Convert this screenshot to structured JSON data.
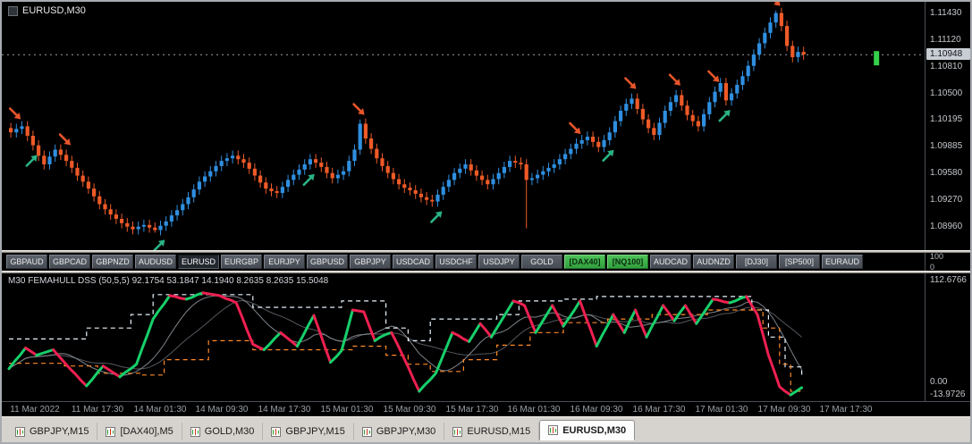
{
  "chart": {
    "symbol_label": "EURUSD,M30",
    "price_axis": {
      "labels": [
        "1.11430",
        "1.11120",
        "1.10810",
        "1.10500",
        "1.10195",
        "1.09885",
        "1.09580",
        "1.09270",
        "1.08960"
      ],
      "current": "1.10948"
    },
    "candles": {
      "closes": [
        1.1005,
        1.1009,
        1.1012,
        1.1001,
        1.099,
        1.0978,
        1.0968,
        1.0977,
        1.0985,
        1.0979,
        1.0972,
        1.0964,
        1.0955,
        1.0948,
        1.094,
        1.0931,
        1.0922,
        1.0916,
        1.091,
        1.0905,
        1.09,
        1.0896,
        1.0893,
        1.0896,
        1.0898,
        1.0895,
        1.0892,
        1.0897,
        1.0902,
        1.0909,
        1.0915,
        1.0922,
        1.093,
        1.0939,
        1.0948,
        1.0954,
        1.096,
        1.0966,
        1.0972,
        1.0975,
        1.0978,
        1.0974,
        1.097,
        1.0963,
        1.0955,
        1.0947,
        1.094,
        1.0937,
        1.0935,
        1.0942,
        1.095,
        1.0956,
        1.0962,
        1.0968,
        1.0974,
        1.097,
        1.0965,
        1.0958,
        1.0952,
        1.0956,
        1.096,
        1.0972,
        1.0985,
        1.1015,
        1.0998,
        1.0986,
        1.0975,
        1.0966,
        1.0958,
        1.0951,
        1.0945,
        1.0941,
        1.0938,
        1.0934,
        1.093,
        1.0927,
        1.0925,
        1.0933,
        1.0942,
        1.095,
        1.0958,
        1.0963,
        1.0968,
        1.0961,
        1.0955,
        1.095,
        1.0945,
        1.0951,
        1.0958,
        1.0965,
        1.0972,
        1.097,
        1.0968,
        1.095,
        1.0952,
        1.0956,
        1.096,
        1.0964,
        1.0968,
        1.0974,
        1.098,
        1.0986,
        1.0992,
        1.0996,
        1.1,
        1.0994,
        1.0988,
        1.0996,
        1.1005,
        1.1018,
        1.103,
        1.1038,
        1.1044,
        1.1032,
        1.102,
        1.101,
        1.1002,
        1.1016,
        1.103,
        1.104,
        1.1048,
        1.1036,
        1.1025,
        1.1018,
        1.1012,
        1.1026,
        1.104,
        1.1052,
        1.1062,
        1.1042,
        1.105,
        1.106,
        1.107,
        1.1082,
        1.1095,
        1.1108,
        1.112,
        1.1132,
        1.1143,
        1.1128,
        1.1105,
        1.1092,
        1.1098,
        1.1095
      ],
      "high_overrides": {
        "63": 1.102,
        "138": 1.1146
      },
      "low_overrides": {
        "26": 1.0889,
        "93": 1.0894
      }
    },
    "arrows": [
      {
        "i": 1,
        "dir": "down"
      },
      {
        "i": 4,
        "dir": "up"
      },
      {
        "i": 10,
        "dir": "down"
      },
      {
        "i": 27,
        "dir": "up"
      },
      {
        "i": 54,
        "dir": "up"
      },
      {
        "i": 63,
        "dir": "down"
      },
      {
        "i": 77,
        "dir": "up"
      },
      {
        "i": 102,
        "dir": "down"
      },
      {
        "i": 108,
        "dir": "up"
      },
      {
        "i": 112,
        "dir": "down"
      },
      {
        "i": 120,
        "dir": "down"
      },
      {
        "i": 127,
        "dir": "down"
      },
      {
        "i": 129,
        "dir": "up"
      },
      {
        "i": 138,
        "dir": "down"
      }
    ],
    "marker": {
      "i": 156,
      "color": "#35d04a"
    }
  },
  "ticker": {
    "axis_labels": [
      "100",
      "0"
    ],
    "buttons": [
      {
        "label": "GBPAUD",
        "variant": "default"
      },
      {
        "label": "GBPCAD",
        "variant": "default"
      },
      {
        "label": "GBPNZD",
        "variant": "default"
      },
      {
        "label": "AUDUSD",
        "variant": "default"
      },
      {
        "label": "EURUSD",
        "variant": "active"
      },
      {
        "label": "EURGBP",
        "variant": "default"
      },
      {
        "label": "EURJPY",
        "variant": "default"
      },
      {
        "label": "GBPUSD",
        "variant": "default"
      },
      {
        "label": "GBPJPY",
        "variant": "default"
      },
      {
        "label": "USDCAD",
        "variant": "default"
      },
      {
        "label": "USDCHF",
        "variant": "default"
      },
      {
        "label": "USDJPY",
        "variant": "default"
      },
      {
        "label": "GOLD",
        "variant": "default"
      },
      {
        "label": "[DAX40]",
        "variant": "green"
      },
      {
        "label": "[NQ100]",
        "variant": "green"
      },
      {
        "label": "AUDCAD",
        "variant": "default"
      },
      {
        "label": "AUDNZD",
        "variant": "default"
      },
      {
        "label": "[DJ30]",
        "variant": "default"
      },
      {
        "label": "[SP500]",
        "variant": "default"
      },
      {
        "label": "EURAUD",
        "variant": "default"
      }
    ]
  },
  "indicator": {
    "label": "M30 FEMAHULL DSS (50,5,5) 92.1754 53.1847 14.1940 8.2635 8.2635 15.5048",
    "axis_labels": [
      "112.6766",
      "0.00",
      "-13.9726"
    ],
    "hull": [
      15,
      23,
      30,
      38,
      34,
      30,
      32,
      34,
      36,
      29,
      22,
      15,
      9,
      2,
      -4,
      3,
      11,
      18,
      14,
      10,
      6,
      11,
      15,
      20,
      37,
      53,
      70,
      79,
      87,
      96,
      95,
      93,
      92,
      94,
      97,
      99,
      98,
      97,
      96,
      93,
      91,
      88,
      73,
      57,
      42,
      39,
      36,
      42,
      49,
      55,
      50,
      45,
      40,
      51,
      63,
      74,
      57,
      39,
      22,
      28,
      35,
      57,
      80,
      79,
      78,
      62,
      46,
      50,
      53,
      55,
      43,
      30,
      17,
      3,
      -10,
      -3,
      3,
      10,
      25,
      40,
      55,
      52,
      48,
      45,
      55,
      65,
      58,
      50,
      60,
      70,
      80,
      90,
      88,
      85,
      70,
      55,
      65,
      75,
      85,
      74,
      62,
      71,
      80,
      90,
      73,
      57,
      40,
      52,
      63,
      75,
      65,
      55,
      68,
      80,
      65,
      50,
      62,
      73,
      85,
      77,
      68,
      77,
      85,
      75,
      65,
      74,
      83,
      92,
      91,
      89,
      88,
      90,
      93,
      95,
      85,
      75,
      53,
      30,
      13,
      -5,
      -10,
      -14,
      -10,
      -6
    ],
    "upper_dashed": [
      {
        "i": 0,
        "v": 48
      },
      {
        "i": 8,
        "v": 48
      },
      {
        "i": 14,
        "v": 60
      },
      {
        "i": 22,
        "v": 75
      },
      {
        "i": 26,
        "v": 97
      },
      {
        "i": 40,
        "v": 97
      },
      {
        "i": 44,
        "v": 83
      },
      {
        "i": 56,
        "v": 83
      },
      {
        "i": 60,
        "v": 90
      },
      {
        "i": 66,
        "v": 90
      },
      {
        "i": 68,
        "v": 60
      },
      {
        "i": 72,
        "v": 46
      },
      {
        "i": 76,
        "v": 70
      },
      {
        "i": 88,
        "v": 75
      },
      {
        "i": 92,
        "v": 90
      },
      {
        "i": 100,
        "v": 92
      },
      {
        "i": 106,
        "v": 95
      },
      {
        "i": 132,
        "v": 95
      },
      {
        "i": 134,
        "v": 80
      },
      {
        "i": 137,
        "v": 50
      },
      {
        "i": 140,
        "v": 17
      },
      {
        "i": 143,
        "v": 8
      }
    ],
    "lower_dashed": [
      {
        "i": 0,
        "v": 21
      },
      {
        "i": 10,
        "v": 18
      },
      {
        "i": 16,
        "v": 10
      },
      {
        "i": 24,
        "v": 8
      },
      {
        "i": 28,
        "v": 25
      },
      {
        "i": 36,
        "v": 46
      },
      {
        "i": 44,
        "v": 36
      },
      {
        "i": 58,
        "v": 36
      },
      {
        "i": 62,
        "v": 40
      },
      {
        "i": 68,
        "v": 30
      },
      {
        "i": 72,
        "v": 20
      },
      {
        "i": 76,
        "v": 12
      },
      {
        "i": 82,
        "v": 25
      },
      {
        "i": 88,
        "v": 41
      },
      {
        "i": 94,
        "v": 55
      },
      {
        "i": 100,
        "v": 66
      },
      {
        "i": 108,
        "v": 70
      },
      {
        "i": 116,
        "v": 75
      },
      {
        "i": 126,
        "v": 80
      },
      {
        "i": 133,
        "v": 80
      },
      {
        "i": 136,
        "v": 60
      },
      {
        "i": 139,
        "v": 20
      },
      {
        "i": 141,
        "v": -10
      },
      {
        "i": 143,
        "v": -12
      }
    ]
  },
  "time_axis": {
    "labels": [
      "11 Mar 2022",
      "11 Mar 17:30",
      "14 Mar 01:30",
      "14 Mar 09:30",
      "14 Mar 17:30",
      "15 Mar 01:30",
      "15 Mar 09:30",
      "15 Mar 17:30",
      "16 Mar 01:30",
      "16 Mar 09:30",
      "16 Mar 17:30",
      "17 Mar 01:30",
      "17 Mar 09:30",
      "17 Mar 17:30"
    ]
  },
  "tabs": {
    "active_index": 6,
    "items": [
      {
        "label": "GBPJPY,M15"
      },
      {
        "label": "[DAX40],M5"
      },
      {
        "label": "GOLD,M30"
      },
      {
        "label": "GBPJPY,M15"
      },
      {
        "label": "GBPJPY,M30"
      },
      {
        "label": "EURUSD,M15"
      },
      {
        "label": "EURUSD,M30"
      }
    ]
  },
  "colors": {
    "up_candle": "#2f8fe0",
    "down_candle": "#ee5a28",
    "arrow_up": "#2bb384",
    "arrow_down": "#e8552a",
    "hull_up": "#17d06b",
    "hull_down": "#ee2050",
    "dash_light": "#e8f4ff",
    "dash_orange": "#ff8a2a",
    "ma_light": "#8d939a",
    "ma_dark": "#5d6268",
    "bid_line": "#9aa0a8"
  }
}
